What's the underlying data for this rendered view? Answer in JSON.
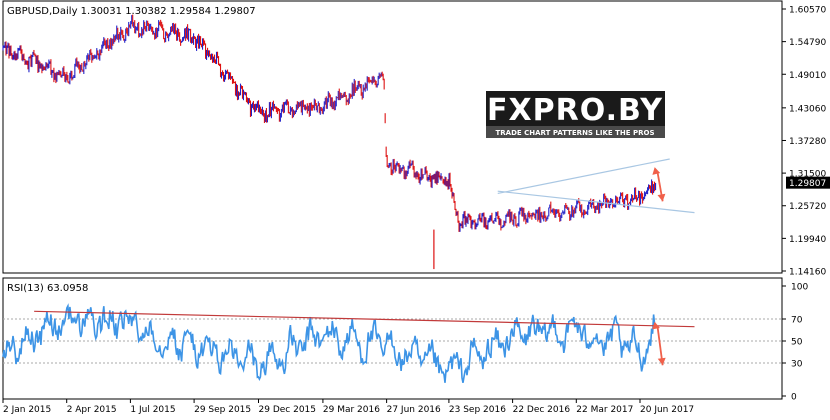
{
  "header": {
    "symbol_line": "GBPUSD,Daily  1.30031 1.30382 1.29584 1.29807",
    "rsi_label": "RSI(13) 63.0958"
  },
  "watermark": {
    "brand": "FXPRO.BY",
    "tagline": "TRADE CHART PATTERNS LIKE THE PROS"
  },
  "colors": {
    "background": "#ffffff",
    "frame": "#000000",
    "bull_bar": "#2020c8",
    "bear_bar": "#dd1111",
    "rsi_line": "#3d94e6",
    "rsi_level": "#a8a8a8",
    "rsi_trend": "#c23a3a",
    "channel_line": "#a9c7e3",
    "arrow": "#f0604a",
    "price_tag_bg": "#000000",
    "price_tag_text": "#ffffff"
  },
  "chart_data": [
    {
      "type": "line",
      "title": "GBPUSD,Daily",
      "subtitle": "1.30031 1.30382 1.29584 1.29807",
      "price_scale": {
        "ticks": [
          "1.60570",
          "1.54790",
          "1.49010",
          "1.43060",
          "1.37280",
          "1.31500",
          "1.25720",
          "1.19940",
          "1.14160"
        ],
        "ylim": [
          1.1416,
          1.6057
        ],
        "current_price": "1.29807",
        "side": "right"
      },
      "time_axis": {
        "ticks": [
          "2 Jan 2015",
          "2 Apr 2015",
          "1 Jul 2015",
          "29 Sep 2015",
          "29 Dec 2015",
          "29 Mar 2016",
          "27 Jun 2016",
          "23 Sep 2016",
          "22 Dec 2016",
          "22 Mar 2017",
          "20 Jun 2017"
        ]
      },
      "x": [
        "2 Jan 2015",
        "2 Apr 2015",
        "1 Jul 2015",
        "29 Sep 2015",
        "29 Dec 2015",
        "29 Mar 2016",
        "23 Jun 2016",
        "27 Jun 2016",
        "23 Sep 2016",
        "7 Oct 2016",
        "22 Dec 2016",
        "22 Mar 2017",
        "20 Jun 2017",
        "12 Jul 2017"
      ],
      "series": [
        {
          "values": [
            1.535,
            1.485,
            1.575,
            1.555,
            1.42,
            1.435,
            1.485,
            1.33,
            1.3,
            1.23,
            1.235,
            1.25,
            1.275,
            1.298
          ]
        }
      ],
      "annotations": [
        {
          "kind": "trendline",
          "from": [
            "1 Dec 2016",
            1.279
          ],
          "to": [
            "1 Aug 2017",
            1.34
          ]
        },
        {
          "kind": "trendline",
          "from": [
            "1 Dec 2016",
            1.283
          ],
          "to": [
            "5 Sep 2017",
            1.245
          ]
        },
        {
          "kind": "arrow",
          "from": [
            "15 Jul 2017",
            1.315
          ],
          "to": [
            "22 Jul 2017",
            1.265
          ]
        }
      ],
      "grid": false,
      "legend": "none"
    },
    {
      "type": "line",
      "title": "RSI(13) 63.0958",
      "scale": {
        "ticks": [
          "100",
          "70",
          "50",
          "30",
          "0"
        ],
        "levels": [
          70,
          50,
          30
        ],
        "ylim": [
          0,
          100
        ],
        "side": "right"
      },
      "x": [
        "2 Jan 2015",
        "2 Apr 2015",
        "1 Jul 2015",
        "29 Sep 2015",
        "29 Dec 2015",
        "29 Mar 2016",
        "27 Jun 2016",
        "23 Sep 2016",
        "22 Dec 2016",
        "22 Mar 2017",
        "20 Jun 2017",
        "12 Jul 2017"
      ],
      "series": [
        {
          "values": [
            40,
            70,
            65,
            45,
            28,
            55,
            45,
            20,
            55,
            60,
            40,
            63.0958
          ]
        }
      ],
      "annotations": [
        {
          "kind": "trendline",
          "from": [
            "15 Feb 2015",
            77
          ],
          "to": [
            "5 Sep 2017",
            63
          ]
        },
        {
          "kind": "arrow",
          "from": [
            "15 Jul 2017",
            62
          ],
          "to": [
            "22 Jul 2017",
            28
          ]
        }
      ],
      "grid": false,
      "legend": "none"
    }
  ]
}
